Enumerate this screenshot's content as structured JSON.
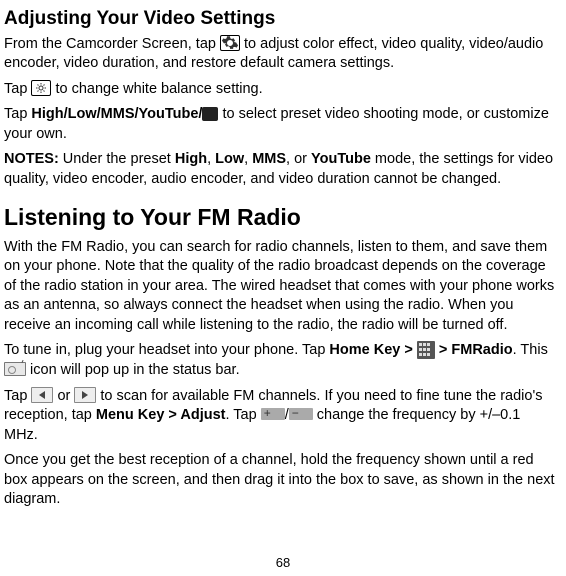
{
  "page_number": "68",
  "heading1": "Adjusting Your Video Settings",
  "para1a": "From the Camcorder Screen, tap ",
  "para1b": " to adjust color effect, video quality, video/audio encoder, video duration, and restore default camera settings.",
  "para2a": "Tap ",
  "para2b": " to change white balance setting.",
  "para3a": "Tap ",
  "para3b_bold": "High/Low/MMS/YouTube/",
  "para3c": " to select preset video shooting mode, or customize your own.",
  "notes_label": "NOTES:",
  "notes_a": " Under the preset ",
  "notes_b1": "High",
  "notes_c1": ", ",
  "notes_b2": "Low",
  "notes_c2": ", ",
  "notes_b3": "MMS",
  "notes_c3": ", or ",
  "notes_b4": "YouTube",
  "notes_d": " mode, the settings for video quality, video encoder, audio encoder, and video duration cannot be changed.",
  "heading2": "Listening to Your FM Radio",
  "fm_para1": "With the FM Radio, you can search for radio channels, listen to them, and save them on your phone. Note that the quality of the radio broadcast depends on the coverage of the radio station in your area. The wired headset that comes with your phone works as an antenna, so always connect the headset when using the radio. When you receive an incoming call while listening to the radio, the radio will be turned off.",
  "fm_para2a": "To tune in, plug your headset into your phone. Tap ",
  "fm_para2b_bold": "Home Key > ",
  "fm_para2c_bold": " > FMRadio",
  "fm_para2d": ". This ",
  "fm_para2e": " icon will pop up in the status bar.",
  "fm_para3a": "Tap ",
  "fm_para3b": " or ",
  "fm_para3c": " to scan for available FM channels. If you need to fine tune the radio's reception, tap ",
  "fm_para3d_bold": "Menu Key > Adjust",
  "fm_para3e": ". Tap ",
  "fm_para3f": "/",
  "fm_para3g": " change the frequency by +/–0.1 MHz.",
  "fm_para4": "Once you get the best reception of a channel, hold the frequency shown until a red box appears on the screen, and then drag it into the box to save, as shown in the next diagram."
}
